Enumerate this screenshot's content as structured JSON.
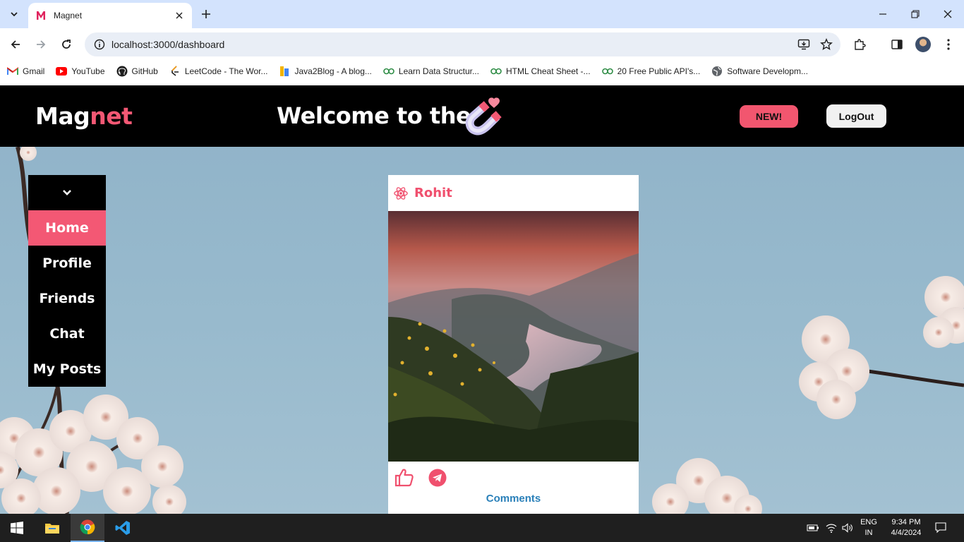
{
  "browser": {
    "tab_title": "Magnet",
    "url": "localhost:3000/dashboard",
    "bookmarks": [
      {
        "label": "Gmail",
        "icon": "gmail-icon"
      },
      {
        "label": "YouTube",
        "icon": "youtube-icon"
      },
      {
        "label": "GitHub",
        "icon": "github-icon"
      },
      {
        "label": "LeetCode - The Wor...",
        "icon": "leetcode-icon"
      },
      {
        "label": "Java2Blog - A blog...",
        "icon": "java2blog-icon"
      },
      {
        "label": "Learn Data Structur...",
        "icon": "geeksforgeeks-icon"
      },
      {
        "label": "HTML Cheat Sheet -...",
        "icon": "geeksforgeeks-icon"
      },
      {
        "label": "20 Free Public API's...",
        "icon": "geeksforgeeks-icon"
      },
      {
        "label": "Software Developm...",
        "icon": "globe-icon"
      }
    ]
  },
  "app": {
    "logo_main": "Mag",
    "logo_accent": "net",
    "welcome": "Welcome to the",
    "new_button": "NEW!",
    "logout_button": "LogOut",
    "colors": {
      "accent": "#f35874",
      "header": "#000000",
      "link": "#2a80b9"
    }
  },
  "sidebar": {
    "items": [
      {
        "label": "Home",
        "active": true
      },
      {
        "label": "Profile"
      },
      {
        "label": "Friends"
      },
      {
        "label": "Chat"
      },
      {
        "label": "My Posts"
      }
    ]
  },
  "post": {
    "author": "Rohit",
    "comments_label": "Comments"
  },
  "taskbar": {
    "lang_line1": "ENG",
    "lang_line2": "IN",
    "time": "9:34 PM",
    "date": "4/4/2024"
  }
}
